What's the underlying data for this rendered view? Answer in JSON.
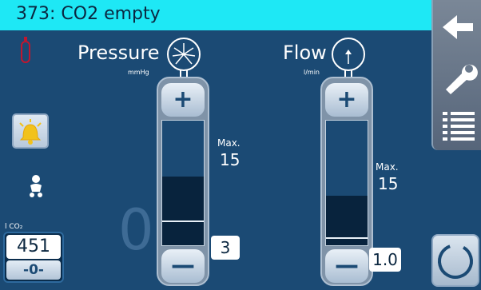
{
  "alarm": {
    "message": "373: CO2 empty"
  },
  "nav": {
    "items": [
      "back-arrow-icon",
      "wrench-icon",
      "menu-list-icon"
    ]
  },
  "left": {
    "co2_label": "l CO₂",
    "co2_volume": "451",
    "reset_label": "-0-"
  },
  "measured_value": "0",
  "pressure": {
    "title": "Pressure",
    "unit": "mmHg",
    "max_label": "Max.",
    "max_value": "15",
    "set_value": "3",
    "plus": "+",
    "minus": "—",
    "fill_level": 0.55,
    "set_level": 0.2
  },
  "flow": {
    "title": "Flow",
    "unit": "l/min",
    "max_label": "Max.",
    "max_value": "15",
    "set_value": "1.0",
    "plus": "+",
    "minus": "—",
    "fill_level": 0.4,
    "set_level": 0.067
  },
  "colors": {
    "background": "#1b4a74",
    "alarm_bar": "#1ee8f5",
    "alarm_text": "#0b2740",
    "cylinder": "#c0172f",
    "bell": "#f2c21b"
  }
}
